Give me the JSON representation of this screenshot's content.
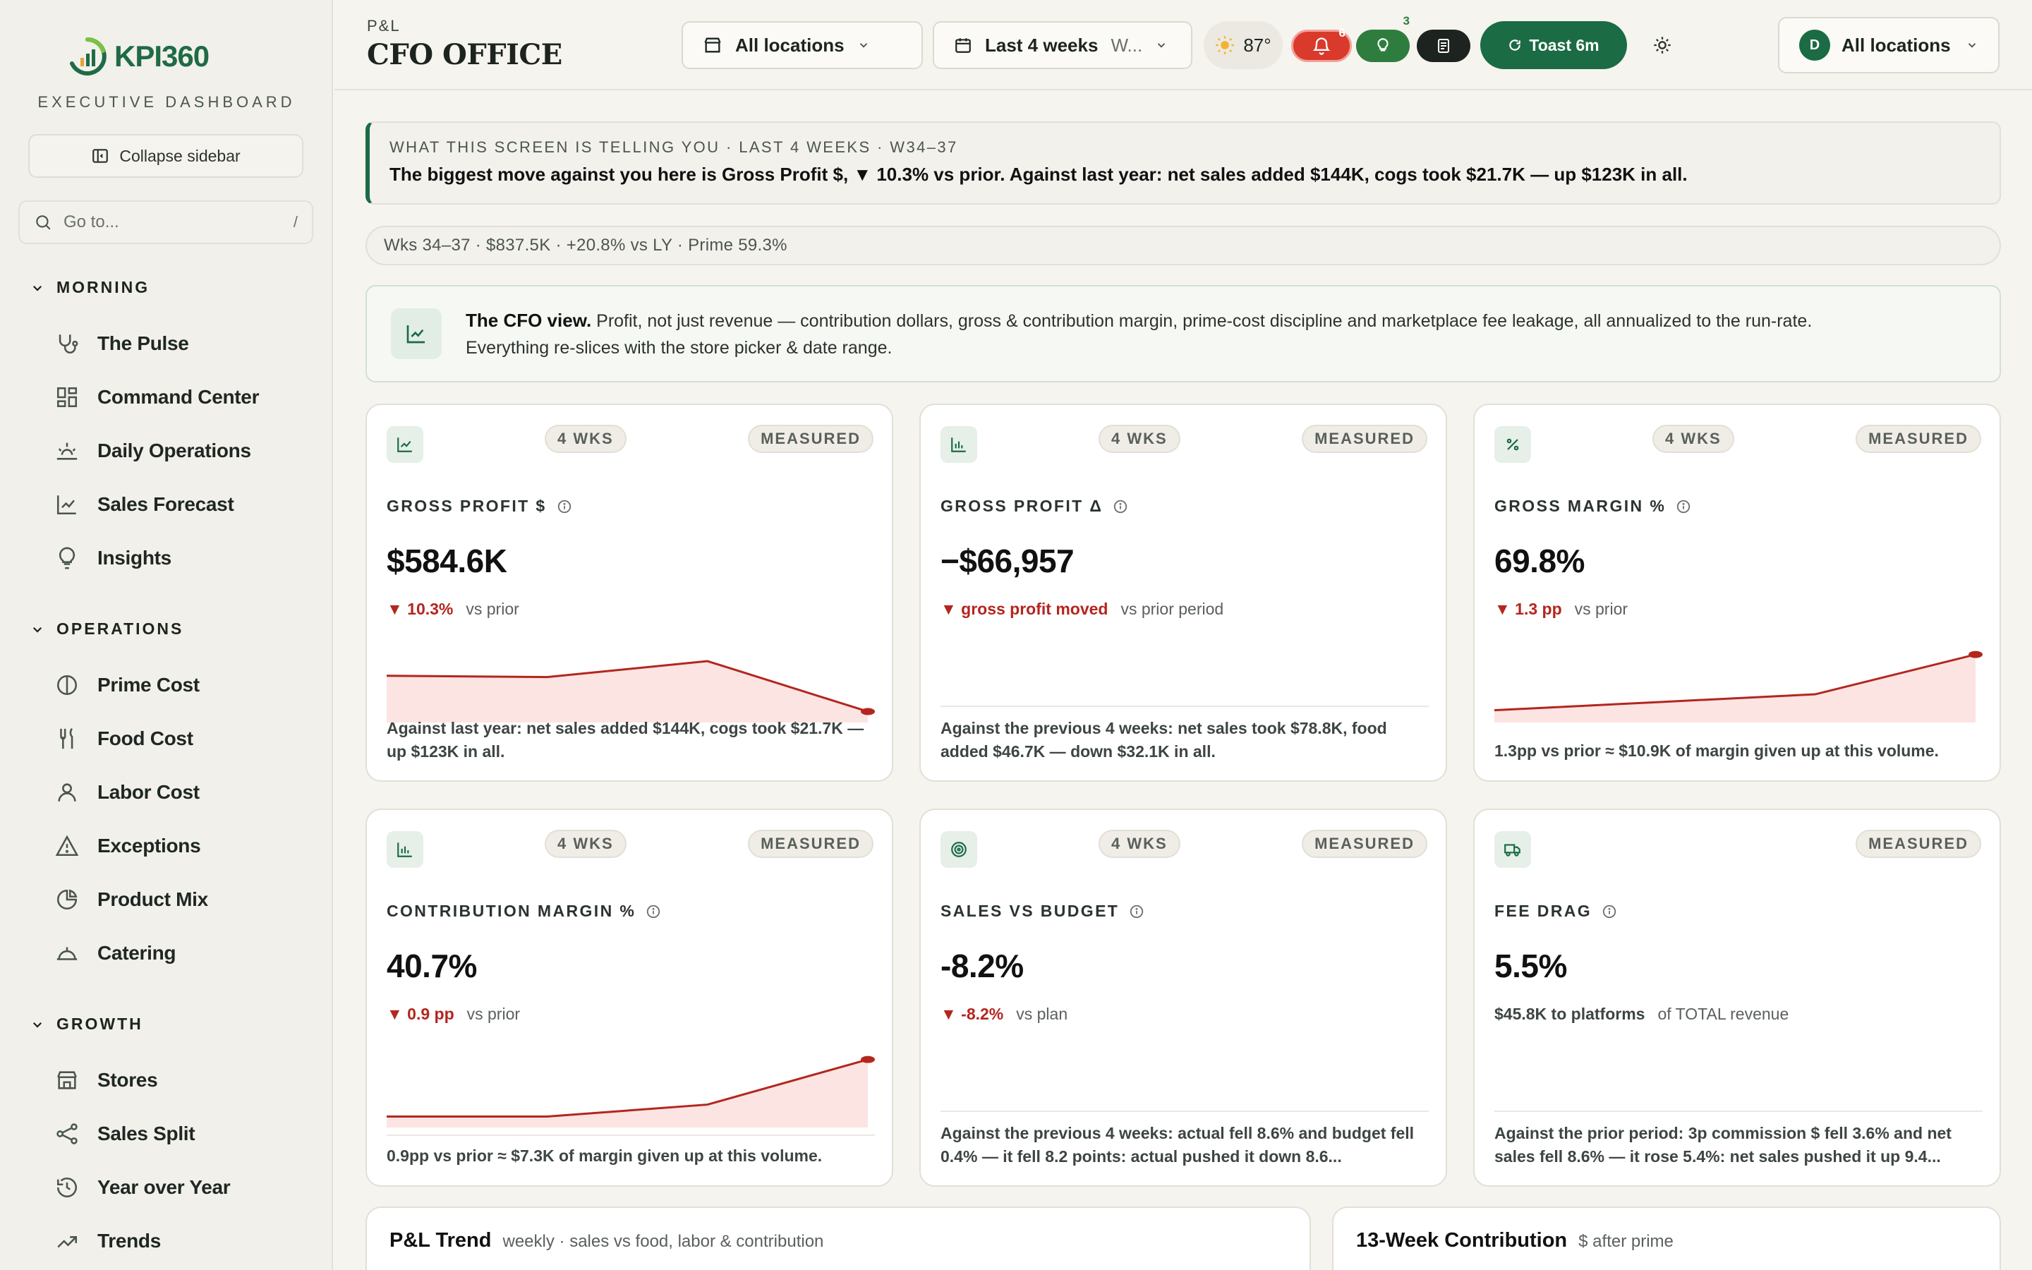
{
  "brand": {
    "name": "KPI360",
    "subtitle": "EXECUTIVE DASHBOARD"
  },
  "sidebar": {
    "collapse_label": "Collapse sidebar",
    "search_placeholder": "Go to...",
    "search_shortcut": "/",
    "sections": [
      {
        "title": "MORNING",
        "items": [
          {
            "label": "The Pulse",
            "icon": "stethoscope-icon"
          },
          {
            "label": "Command Center",
            "icon": "grid-icon"
          },
          {
            "label": "Daily Operations",
            "icon": "sunrise-icon"
          },
          {
            "label": "Sales Forecast",
            "icon": "line-chart-icon"
          },
          {
            "label": "Insights",
            "icon": "lightbulb-icon"
          }
        ]
      },
      {
        "title": "OPERATIONS",
        "items": [
          {
            "label": "Prime Cost",
            "icon": "half-circle-icon"
          },
          {
            "label": "Food Cost",
            "icon": "utensils-icon"
          },
          {
            "label": "Labor Cost",
            "icon": "user-icon"
          },
          {
            "label": "Exceptions",
            "icon": "warning-icon"
          },
          {
            "label": "Product Mix",
            "icon": "pie-chart-icon"
          },
          {
            "label": "Catering",
            "icon": "cloche-icon"
          }
        ]
      },
      {
        "title": "GROWTH",
        "items": [
          {
            "label": "Stores",
            "icon": "store-icon"
          },
          {
            "label": "Sales Split",
            "icon": "share-icon"
          },
          {
            "label": "Year over Year",
            "icon": "history-icon"
          },
          {
            "label": "Trends",
            "icon": "trend-icon"
          }
        ]
      }
    ]
  },
  "header": {
    "breadcrumb": "P&L",
    "title": "CFO OFFICE",
    "location_select": "All locations",
    "date_select": "Last 4 weeks",
    "date_select_suffix": "W...",
    "temperature": "87°",
    "alerts_count": "6",
    "tips_count": "3",
    "toast_label": "Toast 6m",
    "user_initial": "D",
    "user_location": "All locations"
  },
  "callout": {
    "kicker": "WHAT THIS SCREEN IS TELLING YOU · LAST 4 WEEKS · W34–37",
    "text": "The biggest move against you here is Gross Profit $, ▼ 10.3% vs prior. Against last year: net sales added $144K, cogs took $21.7K — up $123K in all."
  },
  "summary": "Wks 34–37 · $837.5K · +20.8% vs LY · Prime 59.3%",
  "cfo_view": {
    "title": "The CFO view.",
    "line1": "Profit, not just revenue — contribution dollars, gross & contribution margin, prime-cost discipline and marketplace fee leakage, all annualized to the run-rate.",
    "line2": "Everything re-slices with the store picker & date range."
  },
  "cards": [
    {
      "tag_wks": "4 WKS",
      "tag_meas": "MEASURED",
      "label": "GROSS PROFIT $",
      "value": "$584.6K",
      "delta": "▼ 10.3%",
      "delta_ctx": "vs prior",
      "note": "Against last year: net sales added $144K, cogs took $21.7K — up $123K in all.",
      "spark": [
        0.62,
        0.6,
        0.84,
        0.08
      ]
    },
    {
      "tag_wks": "4 WKS",
      "tag_meas": "MEASURED",
      "label": "GROSS PROFIT Δ",
      "value": "−$66,957",
      "delta": "▼ gross profit moved",
      "delta_ctx": "vs prior period",
      "note": "Against the previous 4 weeks: net sales took $78.8K, food added $46.7K — down $32.1K in all.",
      "spark": []
    },
    {
      "tag_wks": "4 WKS",
      "tag_meas": "MEASURED",
      "label": "GROSS MARGIN %",
      "value": "69.8%",
      "delta": "▼ 1.3 pp",
      "delta_ctx": "vs prior",
      "note": "1.3pp vs prior ≈ $10.9K of margin given up at this volume.",
      "spark": [
        0.1,
        0.22,
        0.34,
        0.94
      ]
    },
    {
      "tag_wks": "4 WKS",
      "tag_meas": "MEASURED",
      "label": "CONTRIBUTION MARGIN %",
      "value": "40.7%",
      "delta": "▼ 0.9 pp",
      "delta_ctx": "vs prior",
      "note": "0.9pp vs prior ≈ $7.3K of margin given up at this volume.",
      "spark": [
        0.08,
        0.08,
        0.26,
        0.94
      ]
    },
    {
      "tag_wks": "4 WKS",
      "tag_meas": "MEASURED",
      "label": "SALES VS BUDGET",
      "value": "-8.2%",
      "delta": "▼ -8.2%",
      "delta_ctx": "vs plan",
      "note": "Against the previous 4 weeks: actual fell 8.6% and budget fell 0.4% — it fell 8.2 points: actual pushed it down 8.6...",
      "spark": []
    },
    {
      "tag_wks": "",
      "tag_meas": "MEASURED",
      "label": "FEE DRAG",
      "value": "5.5%",
      "delta": "$45.8K to platforms",
      "delta_ctx": "of TOTAL revenue",
      "note": "Against the prior period: 3p commission $ fell 3.6% and net sales fell 8.6% — it rose 5.4%: net sales pushed it up 9.4...",
      "spark": []
    }
  ],
  "bottom": [
    {
      "title": "P&L Trend",
      "subtitle": "weekly · sales vs food, labor & contribution"
    },
    {
      "title": "13-Week Contribution",
      "subtitle": "$ after prime"
    }
  ],
  "colors": {
    "brand": "#1b6b45",
    "negative": "#b3261e",
    "spark_fill": "#fbe4e2"
  }
}
